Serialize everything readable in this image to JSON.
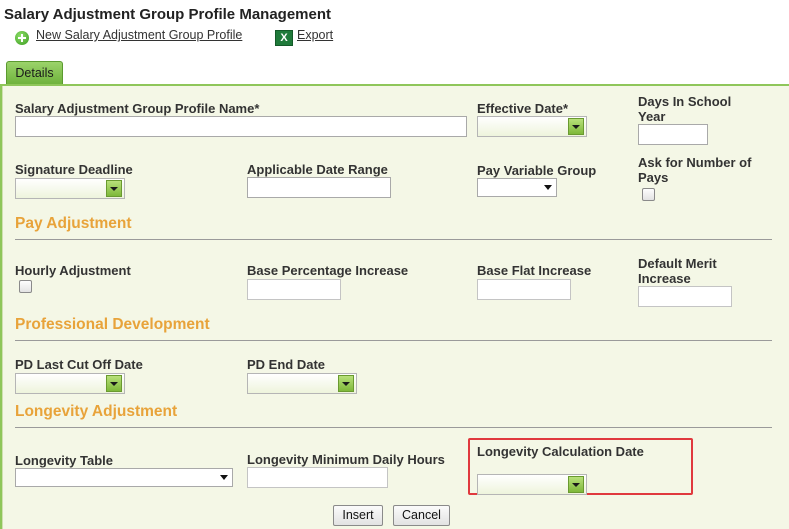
{
  "page": {
    "title": "Salary Adjustment Group Profile Management"
  },
  "toolbar": {
    "new_label": "New Salary Adjustment Group Profile",
    "export_label": "Export",
    "new_icon": "plus-circle-icon",
    "export_icon": "excel-icon"
  },
  "tabs": [
    {
      "label": "Details",
      "active": true
    }
  ],
  "fields": {
    "profile_name": {
      "label": "Salary Adjustment Group Profile Name*",
      "value": ""
    },
    "effective_date": {
      "label": "Effective Date*",
      "value": ""
    },
    "days_in_school_year": {
      "label": "Days In School Year",
      "value": ""
    },
    "signature_deadline": {
      "label": "Signature Deadline",
      "value": ""
    },
    "applicable_date_range": {
      "label": "Applicable Date Range",
      "value": ""
    },
    "pay_variable_group": {
      "label": "Pay Variable Group",
      "value": ""
    },
    "ask_number_of_pays": {
      "label": "Ask for Number of Pays",
      "checked": false
    }
  },
  "sections": {
    "pay_adjustment": {
      "title": "Pay Adjustment",
      "hourly_adjustment": {
        "label": "Hourly Adjustment",
        "checked": false
      },
      "base_percentage_increase": {
        "label": "Base Percentage Increase",
        "value": ""
      },
      "base_flat_increase": {
        "label": "Base Flat Increase",
        "value": ""
      },
      "default_merit_increase": {
        "label": "Default Merit Increase",
        "value": ""
      }
    },
    "professional_development": {
      "title": "Professional Development",
      "pd_last_cut_off_date": {
        "label": "PD Last Cut Off Date",
        "value": ""
      },
      "pd_end_date": {
        "label": "PD End Date",
        "value": ""
      }
    },
    "longevity_adjustment": {
      "title": "Longevity Adjustment",
      "longevity_table": {
        "label": "Longevity Table",
        "value": ""
      },
      "longevity_minimum_daily_hours": {
        "label": "Longevity Minimum Daily Hours",
        "value": ""
      },
      "longevity_calculation_date": {
        "label": "Longevity Calculation Date",
        "value": ""
      }
    }
  },
  "actions": {
    "insert_label": "Insert",
    "cancel_label": "Cancel"
  },
  "colors": {
    "section_title": "#e8a33a",
    "tab_green": "#7fbf45",
    "panel_bg": "#f4f7e6",
    "highlight": "#e0393e"
  }
}
